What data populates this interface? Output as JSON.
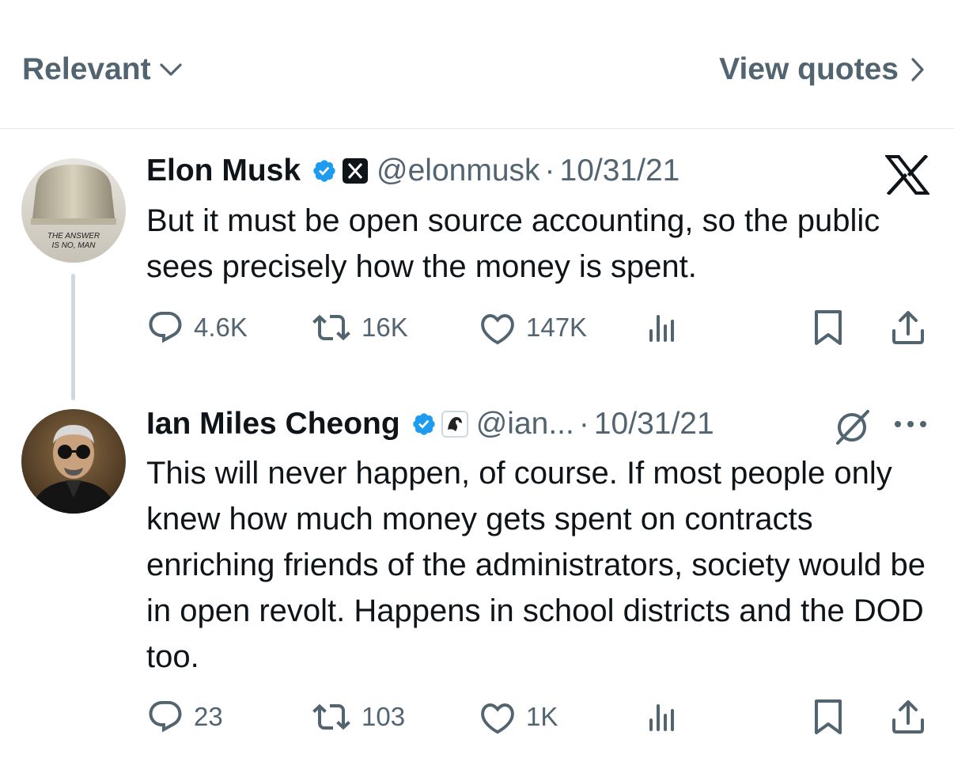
{
  "header": {
    "sort_label": "Relevant",
    "view_quotes_label": "View quotes"
  },
  "tweets": [
    {
      "name": "Elon Musk",
      "handle": "@elonmusk",
      "sep": "·",
      "date": "10/31/21",
      "text": "But it must be open source accounting, so the public sees precisely how the money is spent.",
      "avatar_text": [
        "THE ANSWER",
        "IS NO, MAN"
      ],
      "stats": {
        "replies": "4.6K",
        "reposts": "16K",
        "likes": "147K"
      }
    },
    {
      "name": "Ian Miles Cheong",
      "handle": "@ian...",
      "sep": "·",
      "date": "10/31/21",
      "text": "This will never happen, of course. If most people only knew how much money gets spent on contracts enriching friends of the administrators, society would be in open revolt. Happens in school districts and the DOD too.",
      "stats": {
        "replies": "23",
        "reposts": "103",
        "likes": "1K"
      }
    }
  ],
  "colors": {
    "verified": "#1d9bf0",
    "muted": "#536471",
    "text": "#0f1419",
    "line": "#cfd9de"
  },
  "icons": [
    "chevron-down-icon",
    "chevron-right-icon",
    "verified-badge-icon",
    "x-logo-icon",
    "grok-icon",
    "more-icon",
    "reply-icon",
    "repost-icon",
    "like-icon",
    "views-icon",
    "bookmark-icon",
    "share-icon"
  ]
}
